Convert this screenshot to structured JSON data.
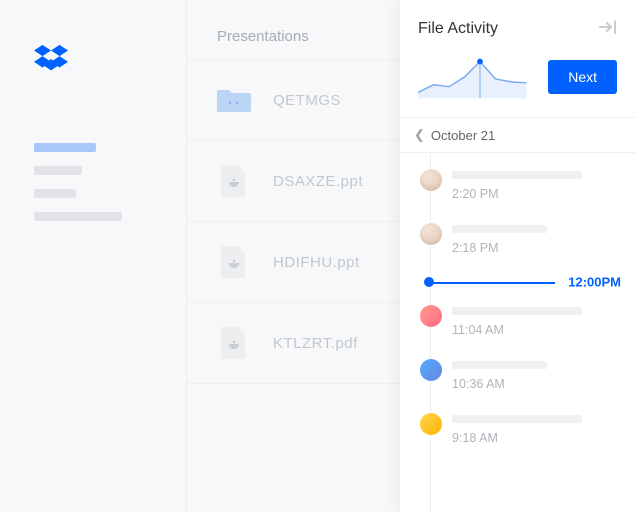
{
  "sidebar": {
    "logo_name": "dropbox-logo"
  },
  "filelist": {
    "heading": "Presentations",
    "files": [
      {
        "name": "QETMGS",
        "type": "folder"
      },
      {
        "name": "DSAXZE.ppt",
        "type": "ppt"
      },
      {
        "name": "HDIFHU.ppt",
        "type": "ppt"
      },
      {
        "name": "KTLZRT.pdf",
        "type": "pdf"
      }
    ]
  },
  "panel": {
    "title": "File Activity",
    "next_label": "Next",
    "date_label": "October 21",
    "slider_time": "12:00PM",
    "activities": [
      {
        "time": "2:20 PM",
        "avatar": "beige"
      },
      {
        "time": "2:18 PM",
        "avatar": "beige"
      },
      {
        "time": "11:04 AM",
        "avatar": "pink"
      },
      {
        "time": "10:36 AM",
        "avatar": "blue"
      },
      {
        "time": "9:18 AM",
        "avatar": "yellow"
      }
    ]
  },
  "chart_data": {
    "type": "area",
    "x": [
      0,
      1,
      2,
      3,
      4,
      5,
      6,
      7
    ],
    "values": [
      6,
      10,
      9,
      15,
      24,
      14,
      12,
      11
    ],
    "ylim": [
      0,
      30
    ],
    "marker_x": 4,
    "marker_y": 24,
    "title": "",
    "xlabel": "",
    "ylabel": ""
  }
}
